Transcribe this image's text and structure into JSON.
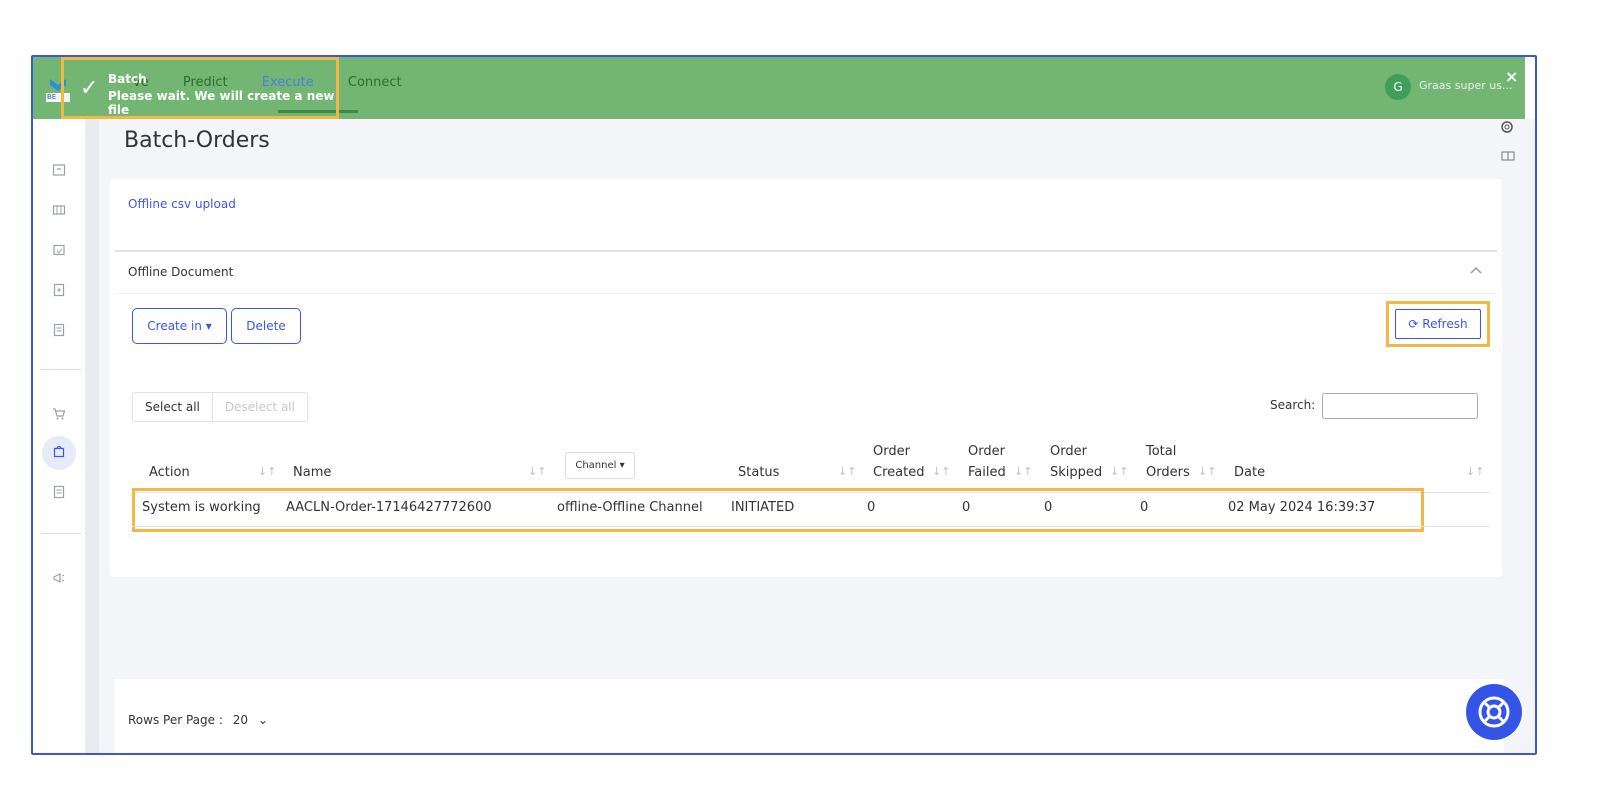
{
  "header": {
    "nav": [
      "ve",
      "Predict",
      "Execute",
      "Connect"
    ],
    "logo_text": "BE",
    "user_initial": "G",
    "user_name": "Graas super us..."
  },
  "toast": {
    "title": "Batch",
    "message": "Please wait. We will create a new file",
    "close": "×",
    "check": "✓"
  },
  "page": {
    "title": "Batch-Orders",
    "tab": "Offline csv upload",
    "section_title": "Offline Document",
    "buttons": {
      "create": "Create in ▾",
      "delete": "Delete",
      "refresh": "⟳ Refresh"
    },
    "select_all": "Select all",
    "deselect_all": "Deselect all",
    "search_label": "Search:",
    "search_value": ""
  },
  "table": {
    "headers": {
      "action": "Action",
      "name": "Name",
      "channel": "Channel ▾",
      "status": "Status",
      "order_created_1": "Order",
      "order_created_2": "Created",
      "order_failed_1": "Order",
      "order_failed_2": "Failed",
      "order_skipped_1": "Order",
      "order_skipped_2": "Skipped",
      "total_orders_1": "Total",
      "total_orders_2": "Orders",
      "date": "Date"
    },
    "rows": [
      {
        "action": "System is working",
        "name": "AACLN-Order-17146427772600",
        "channel": "offline-Offline Channel",
        "status": "INITIATED",
        "order_created": "0",
        "order_failed": "0",
        "order_skipped": "0",
        "total_orders": "0",
        "date": "02 May 2024 16:39:37"
      }
    ]
  },
  "footer": {
    "rows_per_page_label": "Rows Per Page :",
    "rows_per_page_value": "20",
    "chevron": "⌄"
  },
  "colors": {
    "accent": "#3a57e8",
    "toast_bg": "#73b573",
    "highlight": "#f3b843"
  }
}
